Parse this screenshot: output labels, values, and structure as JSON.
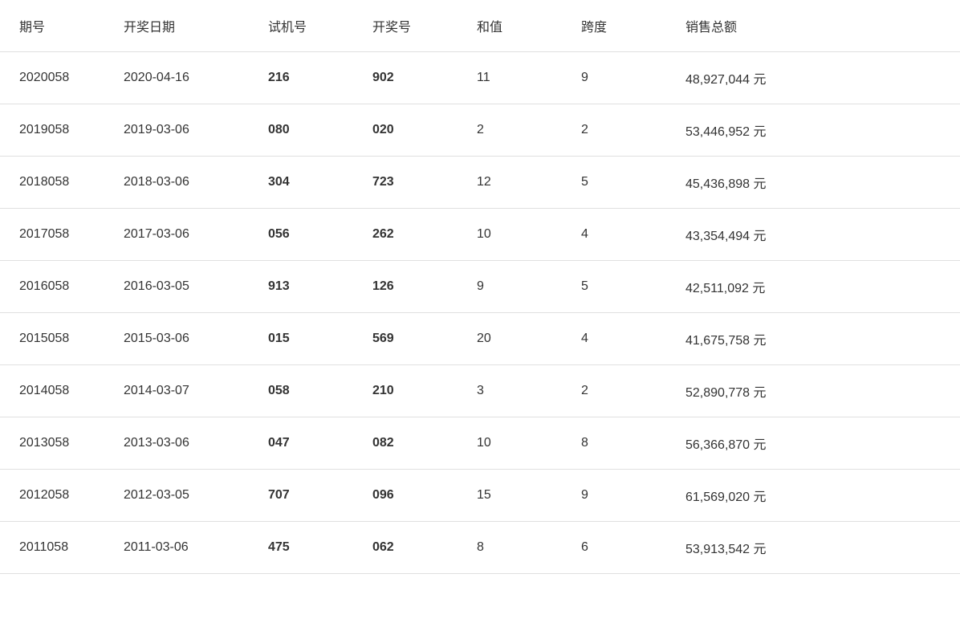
{
  "table": {
    "headers": [
      "期号",
      "开奖日期",
      "试机号",
      "开奖号",
      "和值",
      "跨度",
      "销售总额"
    ],
    "rows": [
      {
        "qihao": "2020058",
        "date": "2020-04-16",
        "shiji": "216",
        "kaij": "902",
        "hezhi": "11",
        "kuadu": "9",
        "sales": "48,927,044 元"
      },
      {
        "qihao": "2019058",
        "date": "2019-03-06",
        "shiji": "080",
        "kaij": "020",
        "hezhi": "2",
        "kuadu": "2",
        "sales": "53,446,952 元"
      },
      {
        "qihao": "2018058",
        "date": "2018-03-06",
        "shiji": "304",
        "kaij": "723",
        "hezhi": "12",
        "kuadu": "5",
        "sales": "45,436,898 元"
      },
      {
        "qihao": "2017058",
        "date": "2017-03-06",
        "shiji": "056",
        "kaij": "262",
        "hezhi": "10",
        "kuadu": "4",
        "sales": "43,354,494 元"
      },
      {
        "qihao": "2016058",
        "date": "2016-03-05",
        "shiji": "913",
        "kaij": "126",
        "hezhi": "9",
        "kuadu": "5",
        "sales": "42,511,092 元"
      },
      {
        "qihao": "2015058",
        "date": "2015-03-06",
        "shiji": "015",
        "kaij": "569",
        "hezhi": "20",
        "kuadu": "4",
        "sales": "41,675,758 元"
      },
      {
        "qihao": "2014058",
        "date": "2014-03-07",
        "shiji": "058",
        "kaij": "210",
        "hezhi": "3",
        "kuadu": "2",
        "sales": "52,890,778 元"
      },
      {
        "qihao": "2013058",
        "date": "2013-03-06",
        "shiji": "047",
        "kaij": "082",
        "hezhi": "10",
        "kuadu": "8",
        "sales": "56,366,870 元"
      },
      {
        "qihao": "2012058",
        "date": "2012-03-05",
        "shiji": "707",
        "kaij": "096",
        "hezhi": "15",
        "kuadu": "9",
        "sales": "61,569,020 元"
      },
      {
        "qihao": "2011058",
        "date": "2011-03-06",
        "shiji": "475",
        "kaij": "062",
        "hezhi": "8",
        "kuadu": "6",
        "sales": "53,913,542 元"
      }
    ]
  }
}
